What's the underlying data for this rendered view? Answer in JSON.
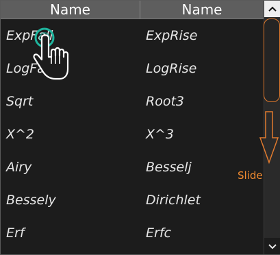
{
  "table": {
    "headers": [
      "Name",
      "Name"
    ],
    "rows": [
      [
        "ExpFall",
        "ExpRise"
      ],
      [
        "LogFall",
        "LogRise"
      ],
      [
        "Sqrt",
        "Root3"
      ],
      [
        "X^2",
        "X^3"
      ],
      [
        "Airy",
        "Besselj"
      ],
      [
        "Bessely",
        "Dirichlet"
      ],
      [
        "Erf",
        "Erfc"
      ]
    ]
  },
  "annotation": {
    "slide_label": "Slide"
  },
  "icons": {
    "scroll_up": "chevron-up-icon",
    "scroll_down": "chevron-down-icon",
    "tap_gesture": "hand-tap-icon",
    "slide_direction": "arrow-down-icon"
  },
  "colors": {
    "accent": "#e07a2e",
    "tap_ring": "#1fb59e",
    "header_bg": "#5e5e5e",
    "panel_bg": "#1c1c1c"
  }
}
